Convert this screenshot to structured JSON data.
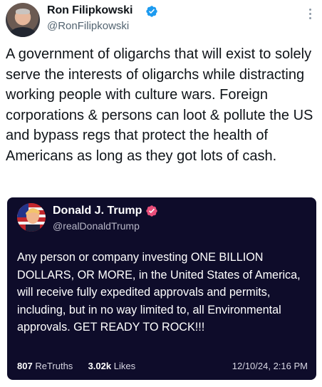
{
  "author": {
    "name": "Ron Filipkowski",
    "handle": "@RonFilipkowski"
  },
  "post": {
    "text": "A government of oligarchs that will exist to solely serve the interests of oligarchs while distracting working people with culture wars. Foreign corporations & persons can loot & pollute the US and bypass regs that protect the health of Americans as long as they got lots of cash."
  },
  "quoted": {
    "name": "Donald J. Trump",
    "handle": "@realDonaldTrump",
    "text": "Any person or company investing ONE BILLION DOLLARS, OR MORE, in the United States of America, will receive fully expedited approvals and permits, including, but in no way limited to, all Environmental approvals. GET READY TO ROCK!!!",
    "retruths_count": "807",
    "retruths_label": "ReTruths",
    "likes_count": "3.02k",
    "likes_label": "Likes",
    "date": "12/10/24, 2:16 PM"
  },
  "colors": {
    "verified": "#1d9bf0",
    "card_bg": "#0e0c2a",
    "truth_badge": "#e84e7a"
  },
  "icons": [
    "more-options-icon",
    "verified-icon",
    "truth-verified-icon"
  ]
}
